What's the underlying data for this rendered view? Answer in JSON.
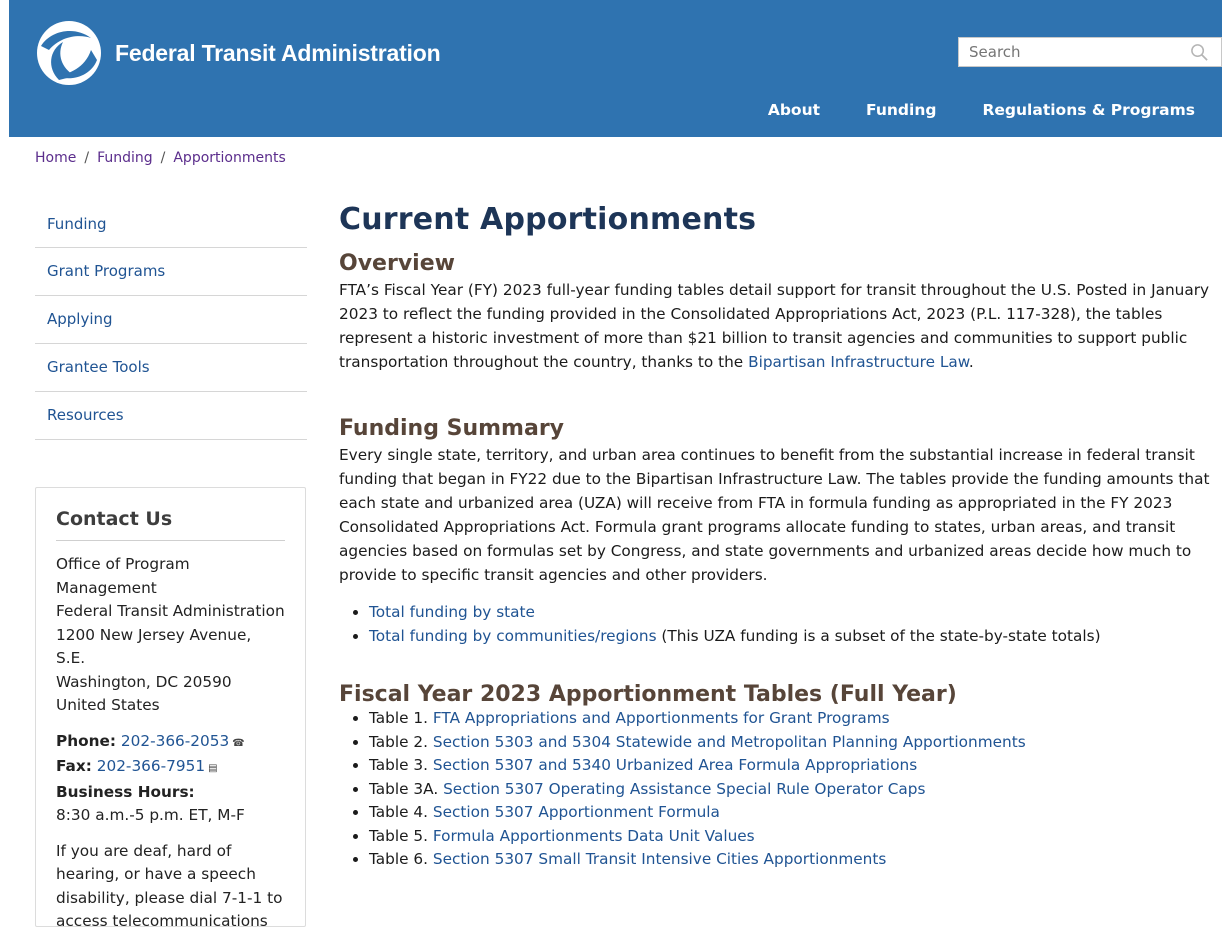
{
  "header": {
    "org_name": "Federal Transit Administration",
    "search_placeholder": "Search",
    "nav": [
      "About",
      "Funding",
      "Regulations & Programs"
    ]
  },
  "breadcrumb": [
    "Home",
    "Funding",
    "Apportionments"
  ],
  "sidebar": {
    "items": [
      "Funding",
      "Grant Programs",
      "Applying",
      "Grantee Tools",
      "Resources"
    ]
  },
  "contact": {
    "title": "Contact Us",
    "address_lines": [
      "Office of Program",
      "Management",
      "Federal Transit Administration",
      "1200 New Jersey Avenue, S.E.",
      "Washington, DC 20590",
      "United States"
    ],
    "phone_label": "Phone:",
    "phone": "202-366-2053",
    "fax_label": "Fax:",
    "fax": "202-366-7951",
    "hours_label": "Business Hours:",
    "hours": "8:30 a.m.-5 p.m. ET, M-F",
    "deaf_lines": [
      "If you are deaf, hard of",
      "hearing, or have a speech",
      "disability, please dial 7-1-1 to",
      "access telecommunications"
    ]
  },
  "main": {
    "title": "Current Apportionments",
    "overview": {
      "heading": "Overview",
      "text_before_link": "FTA’s Fiscal Year (FY) 2023 full-year funding tables detail support for transit throughout the U.S. Posted in January 2023 to reflect the funding provided in the Consolidated Appropriations Act, 2023 (P.L. 117-328), the tables represent a historic investment of more than $21 billion to transit agencies and communities to support public transportation throughout the country, thanks to the ",
      "link": "Bipartisan Infrastructure Law",
      "text_after_link": "."
    },
    "funding_summary": {
      "heading": "Funding Summary",
      "text": "Every single state, territory, and urban area continues to benefit from the substantial increase in federal transit funding that began in FY22 due to the Bipartisan Infrastructure Law. The tables provide the funding amounts that each state and urbanized area (UZA) will receive from FTA in formula funding as appropriated in the FY 2023 Consolidated Appropriations Act. Formula grant programs allocate funding to states, urban areas, and transit agencies based on formulas set by Congress, and state governments and urbanized areas decide how much to provide to specific transit agencies and other providers.",
      "links": [
        {
          "link": "Total funding by state",
          "suffix": ""
        },
        {
          "link": "Total funding by communities/regions",
          "suffix": " (This UZA funding is a subset of the state-by-state totals)"
        }
      ]
    },
    "tables": {
      "heading": "Fiscal Year 2023 Apportionment Tables (Full Year)",
      "items": [
        {
          "prefix": "Table 1. ",
          "link": "FTA Appropriations and Apportionments for Grant Programs"
        },
        {
          "prefix": "Table 2. ",
          "link": "Section 5303 and 5304 Statewide and Metropolitan Planning Apportionments"
        },
        {
          "prefix": "Table 3. ",
          "link": "Section 5307 and 5340 Urbanized Area Formula Appropriations"
        },
        {
          "prefix": "Table 3A. ",
          "link": "Section 5307 Operating Assistance Special Rule Operator Caps"
        },
        {
          "prefix": "Table 4. ",
          "link": "Section 5307 Apportionment Formula"
        },
        {
          "prefix": "Table 5. ",
          "link": "Formula Apportionments Data Unit Values"
        },
        {
          "prefix": "Table 6. ",
          "link": "Section 5307 Small Transit Intensive Cities Apportionments"
        }
      ]
    }
  }
}
